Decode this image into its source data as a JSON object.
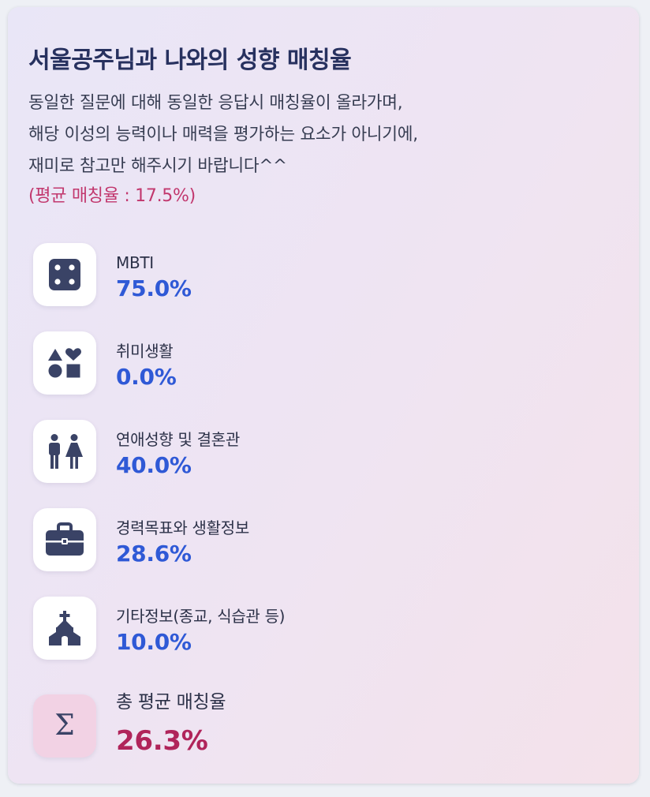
{
  "header": {
    "title": "서울공주님과 나와의 성향 매칭율",
    "description": [
      "동일한 질문에 대해 동일한 응답시 매칭율이 올라가며,",
      "해당 이성의 능력이나 매력을 평가하는 요소가 아니기에,",
      "재미로 참고만 해주시기 바랍니다^^"
    ],
    "average": "(평균 매칭율 : 17.5%)"
  },
  "items": [
    {
      "icon": "dice-icon",
      "label": "MBTI",
      "value": "75.0%"
    },
    {
      "icon": "shapes-icon",
      "label": "취미생활",
      "value": "0.0%"
    },
    {
      "icon": "couple-icon",
      "label": "연애성향 및 결혼관",
      "value": "40.0%"
    },
    {
      "icon": "briefcase-icon",
      "label": "경력목표와 생활정보",
      "value": "28.6%"
    },
    {
      "icon": "church-icon",
      "label": "기타정보(종교, 식습관 등)",
      "value": "10.0%"
    }
  ],
  "total": {
    "icon": "sigma-icon",
    "icon_glyph": "Σ",
    "label": "총 평균 매칭율",
    "value": "26.3%"
  },
  "colors": {
    "title": "#27315f",
    "value": "#2f59d6",
    "average": "#c2386e",
    "total_value": "#b0245a",
    "icon": "#3a4366"
  }
}
